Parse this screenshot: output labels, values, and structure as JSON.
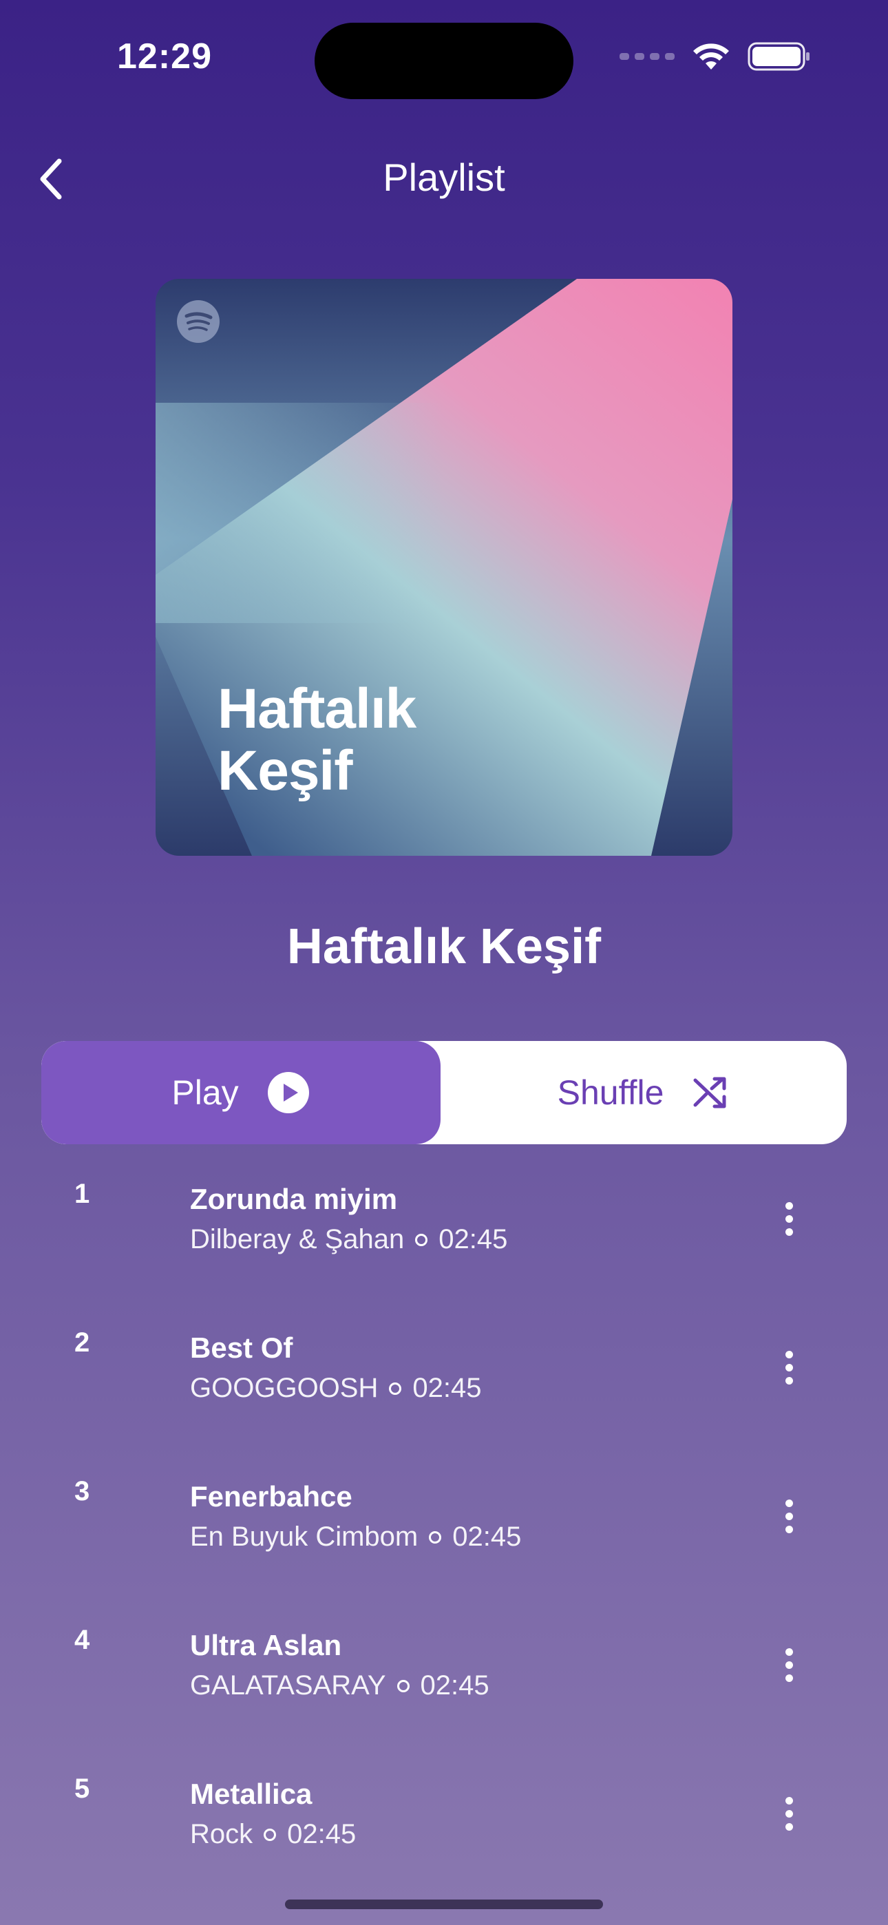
{
  "status_bar": {
    "time": "12:29"
  },
  "nav": {
    "title": "Playlist",
    "back_icon": "chevron-left-icon"
  },
  "cover": {
    "title": "Haftalık Keşif",
    "logo_icon": "spotify-logo-icon",
    "colors": {
      "navy": "#2f3f73",
      "pink": "#ef88b4",
      "teal": "#a5cfd8"
    }
  },
  "playlist": {
    "title": "Haftalık Keşif"
  },
  "actions": {
    "play_label": "Play",
    "play_icon": "play-circle-icon",
    "shuffle_label": "Shuffle",
    "shuffle_icon": "shuffle-icon"
  },
  "tracks": [
    {
      "number": "1",
      "title": "Zorunda miyim",
      "artist": "Dilberay & Şahan",
      "duration": "02:45"
    },
    {
      "number": "2",
      "title": "Best Of",
      "artist": "GOOGGOOSH",
      "duration": "02:45"
    },
    {
      "number": "3",
      "title": "Fenerbahce",
      "artist": "En Buyuk Cimbom",
      "duration": "02:45"
    },
    {
      "number": "4",
      "title": "Ultra Aslan",
      "artist": "GALATASARAY",
      "duration": "02:45"
    },
    {
      "number": "5",
      "title": "Metallica",
      "artist": "Rock",
      "duration": "02:45"
    }
  ],
  "colors": {
    "accent": "#7d57c1",
    "accent_text": "#6a3fb3",
    "bg_top": "#3b2286",
    "bg_bottom": "#8a78b0"
  }
}
